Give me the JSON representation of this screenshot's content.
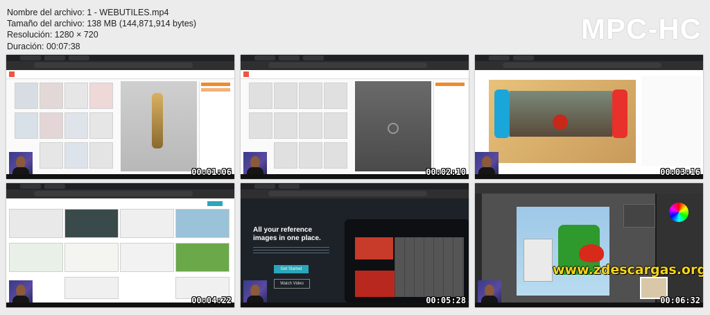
{
  "file_info": {
    "name": "Nombre del archivo: 1 - WEBUTILES.mp4",
    "size": "Tamaño del archivo: 138 MB (144,871,914 bytes)",
    "resolution": "Resolución: 1280 × 720",
    "duration": "Duración: 00:07:38"
  },
  "player_logo": "MPC-HC",
  "thumbnails": [
    {
      "timestamp": "00:01:06"
    },
    {
      "timestamp": "00:02:10"
    },
    {
      "timestamp": "00:03:16"
    },
    {
      "timestamp": "00:04:22"
    },
    {
      "timestamp": "00:05:28"
    },
    {
      "timestamp": "00:06:32"
    }
  ],
  "thumb5": {
    "headline": "All your reference images in one place.",
    "cta_primary": "Get Started",
    "cta_secondary": "Watch Video"
  },
  "thumb6_watermark": "www.zdescargas.org",
  "colors": {
    "accent_orange": "#f08a2a",
    "teal": "#2aa7b8"
  }
}
